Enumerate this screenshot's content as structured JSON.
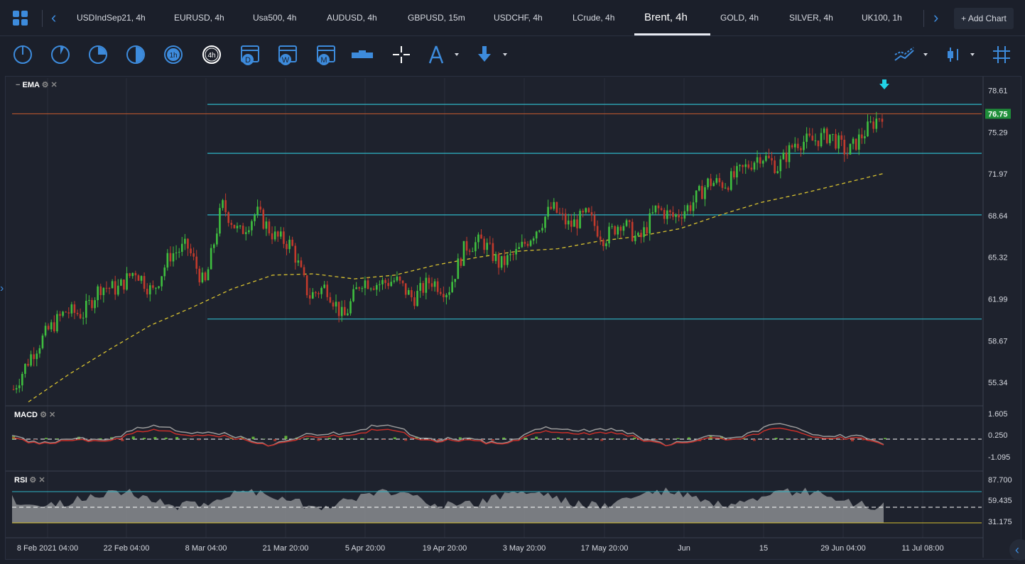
{
  "tabs": {
    "items": [
      "USDIndSep21, 4h",
      "EURUSD, 4h",
      "Usa500, 4h",
      "AUDUSD, 4h",
      "GBPUSD, 15m",
      "USDCHF, 4h",
      "LCrude, 4h",
      "Brent, 4h",
      "GOLD, 4h",
      "SILVER, 4h",
      "UK100, 1h"
    ],
    "active_index": 7,
    "add_chart_label": "+ Add Chart"
  },
  "toolbar": {
    "timeframe_buttons": [
      "1m",
      "5m",
      "15m",
      "30m",
      "1h",
      "4h",
      "D",
      "W",
      "M"
    ],
    "active_timeframe": "4h",
    "tools": [
      "range-icon",
      "crosshair-icon",
      "drawing-compass-icon",
      "download-arrow-icon"
    ],
    "right_tools": [
      "indicators-icon",
      "candlestick-type-icon",
      "grid-icon"
    ]
  },
  "panes": {
    "main": {
      "label": "EMA"
    },
    "macd": {
      "label": "MACD"
    },
    "rsi": {
      "label": "RSI"
    }
  },
  "colors": {
    "up": "#3fbf3f",
    "down": "#c23a2c",
    "ema": "#d8c230",
    "hline": "#2fb7c7",
    "price_line": "#b5552e",
    "price_badge": "#1f8f3a",
    "accent": "#3d8bdc"
  },
  "chart_data": {
    "type": "candlestick",
    "symbol": "Brent, 4h",
    "current_price": "76.75",
    "y_ticks": [
      "78.61",
      "75.29",
      "71.97",
      "68.64",
      "65.32",
      "61.99",
      "58.67",
      "55.34"
    ],
    "y_tick_values": [
      78.61,
      75.29,
      71.97,
      68.64,
      65.32,
      61.99,
      58.67,
      55.34
    ],
    "ylim": [
      53.6,
      79.6
    ],
    "x_ticks": [
      "8 Feb 2021 04:00",
      "22 Feb 04:00",
      "8 Mar 04:00",
      "21 Mar 20:00",
      "5 Apr 20:00",
      "19 Apr 20:00",
      "3 May 20:00",
      "17 May 20:00",
      "Jun",
      "15",
      "29 Jun 04:00",
      "11 Jul 08:00"
    ],
    "horizontal_levels": [
      77.5,
      73.6,
      68.7,
      60.4
    ],
    "price_level": 76.75,
    "close_path": [
      54.8,
      57.5,
      59.5,
      61.0,
      60.8,
      63.0,
      62.8,
      64.3,
      62.5,
      65.5,
      66.2,
      63.0,
      69.5,
      67.2,
      68.9,
      67.0,
      66.3,
      62.2,
      63.0,
      60.4,
      63.5,
      63.2,
      63.5,
      62.0,
      63.5,
      62.6,
      66.2,
      66.6,
      64.7,
      65.7,
      67.4,
      69.3,
      67.8,
      68.7,
      66.8,
      68.2,
      66.6,
      69.2,
      68.5,
      69.5,
      71.3,
      71.2,
      72.3,
      73.5,
      72.5,
      74.5,
      74.6,
      75.1,
      73.6,
      75.3,
      76.8
    ],
    "ema_path": [
      53.8,
      56.0,
      58.0,
      59.9,
      61.3,
      62.8,
      63.9,
      64.0,
      63.6,
      63.9,
      64.7,
      65.3,
      65.8,
      66.0,
      66.6,
      67.0,
      67.6,
      68.7,
      69.7,
      70.4,
      71.2,
      72.0
    ],
    "signal_arrow": "down",
    "macd": {
      "ticks": [
        "1.605",
        "0.250",
        "-1.095"
      ],
      "tick_values": [
        1.605,
        0.25,
        -1.095
      ],
      "zero_line": 0.25
    },
    "rsi": {
      "ticks": [
        "87.700",
        "59.435",
        "31.175"
      ],
      "tick_values": [
        87.7,
        59.435,
        31.175
      ],
      "upper": 70,
      "lower": 30
    }
  }
}
